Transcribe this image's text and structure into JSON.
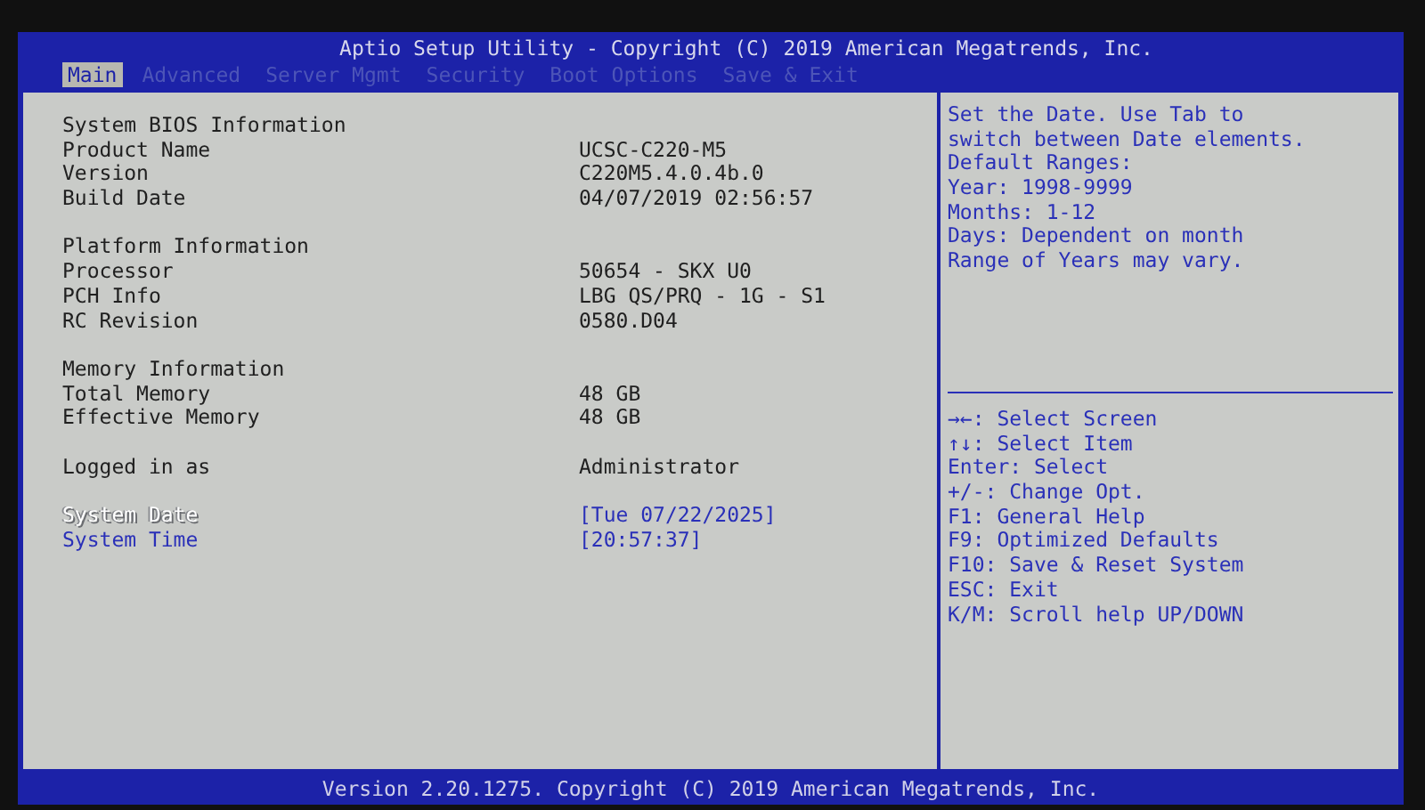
{
  "header": {
    "title": "Aptio Setup Utility - Copyright (C) 2019 American Megatrends, Inc."
  },
  "tabs": [
    {
      "label": "Main",
      "selected": true
    },
    {
      "label": "Advanced",
      "selected": false
    },
    {
      "label": "Server Mgmt",
      "selected": false
    },
    {
      "label": "Security",
      "selected": false
    },
    {
      "label": "Boot Options",
      "selected": false
    },
    {
      "label": "Save & Exit",
      "selected": false
    }
  ],
  "groups": [
    {
      "heading": "System BIOS Information",
      "rows": [
        {
          "kind": "info",
          "label": "Product Name",
          "value": "UCSC-C220-M5"
        },
        {
          "kind": "info",
          "label": "Version",
          "value": "C220M5.4.0.4b.0"
        },
        {
          "kind": "info",
          "label": "Build Date",
          "value": "04/07/2019 02:56:57"
        }
      ]
    },
    {
      "heading": "Platform Information",
      "rows": [
        {
          "kind": "info",
          "label": "Processor",
          "value": "50654 - SKX U0"
        },
        {
          "kind": "info",
          "label": "PCH Info",
          "value": "LBG QS/PRQ - 1G - S1"
        },
        {
          "kind": "info",
          "label": "RC Revision",
          "value": "0580.D04"
        }
      ]
    },
    {
      "heading": "Memory Information",
      "rows": [
        {
          "kind": "info",
          "label": "Total Memory",
          "value": "48 GB"
        },
        {
          "kind": "info",
          "label": "Effective Memory",
          "value": "48 GB"
        }
      ]
    },
    {
      "rows": [
        {
          "kind": "info",
          "label": "Logged in as",
          "value": "Administrator"
        }
      ]
    },
    {
      "rows": [
        {
          "kind": "setting",
          "label": "System Date",
          "value": "[Tue 07/22/2025]",
          "selected": true
        },
        {
          "kind": "setting",
          "label": "System Time",
          "value": "[20:57:37]",
          "selected": false
        }
      ]
    }
  ],
  "help": {
    "description": [
      "Set the Date. Use Tab to",
      "switch between Date elements.",
      "Default Ranges:",
      "Year: 1998-9999",
      "Months: 1-12",
      "Days: Dependent on month",
      "Range of Years may vary."
    ],
    "keys": [
      "→←: Select Screen",
      "↑↓: Select Item",
      "Enter: Select",
      "+/-: Change Opt.",
      "F1: General Help",
      "F9: Optimized Defaults",
      "F10: Save & Reset System",
      "ESC: Exit",
      "K/M: Scroll help UP/DOWN"
    ]
  },
  "footer": {
    "text": "Version 2.20.1275. Copyright (C) 2019 American Megatrends, Inc."
  }
}
